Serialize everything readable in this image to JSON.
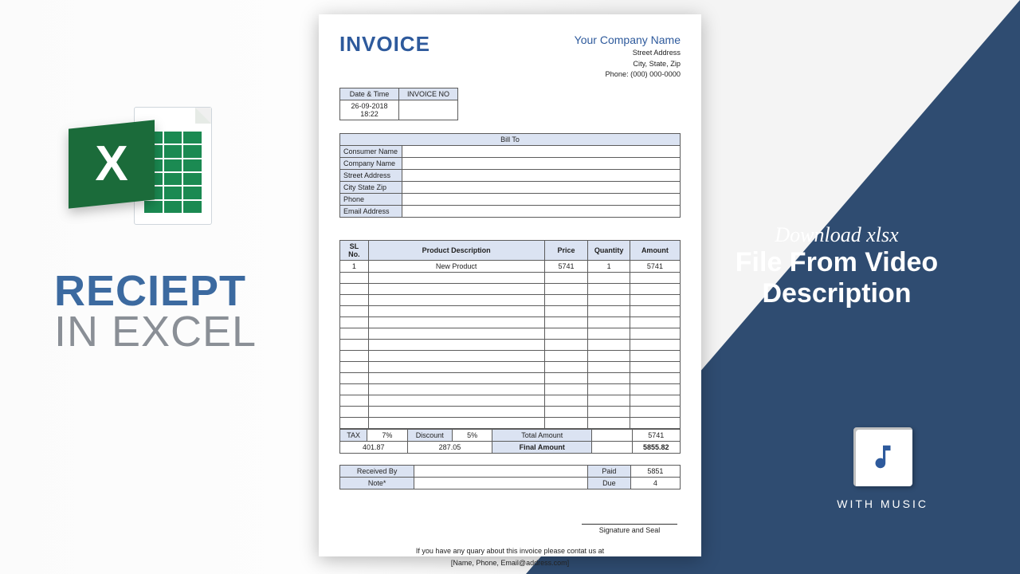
{
  "left": {
    "badge": "X",
    "line1": "RECIEPT",
    "line2": "IN EXCEL"
  },
  "right": {
    "l1": "Download xlsx",
    "l2a": "File From Video",
    "l2b": "Description",
    "music": "WITH MUSIC"
  },
  "invoice": {
    "title": "INVOICE",
    "company": {
      "name": "Your Company Name",
      "street": "Street Address",
      "csz": "City, State, Zip",
      "phone": "Phone: (000) 000-0000"
    },
    "dt": {
      "h1": "Date & Time",
      "h2": "INVOICE NO",
      "v1": "26-09-2018 18:22",
      "v2": ""
    },
    "billto": {
      "header": "Bill To",
      "rows": [
        "Consumer Name",
        "Company Name",
        "Street Address",
        "City State Zip",
        "Phone",
        "Email Address"
      ]
    },
    "items": {
      "headers": [
        "SL No.",
        "Product Description",
        "Price",
        "Quantity",
        "Amount"
      ],
      "rows": [
        {
          "sl": "1",
          "desc": "New Product",
          "price": "5741",
          "qty": "1",
          "amt": "5741"
        }
      ],
      "blank_rows": 14
    },
    "totals": {
      "tax_lab": "TAX",
      "tax_pct": "7%",
      "disc_lab": "Discount",
      "disc_pct": "5%",
      "total_lab": "Total Amount",
      "total_val": "5741",
      "tax_val": "401.87",
      "disc_val": "287.05",
      "final_lab": "Final Amount",
      "final_val": "5855.82"
    },
    "pay": {
      "recv": "Received By",
      "note": "Note*",
      "paid_lab": "Paid",
      "paid_val": "5851",
      "due_lab": "Due",
      "due_val": "4"
    },
    "footer": {
      "l1": "If you have any quary about this invoice please contat us at",
      "l2": "[Name, Phone, Email@address.com]",
      "sig": "Signature and Seal"
    }
  }
}
